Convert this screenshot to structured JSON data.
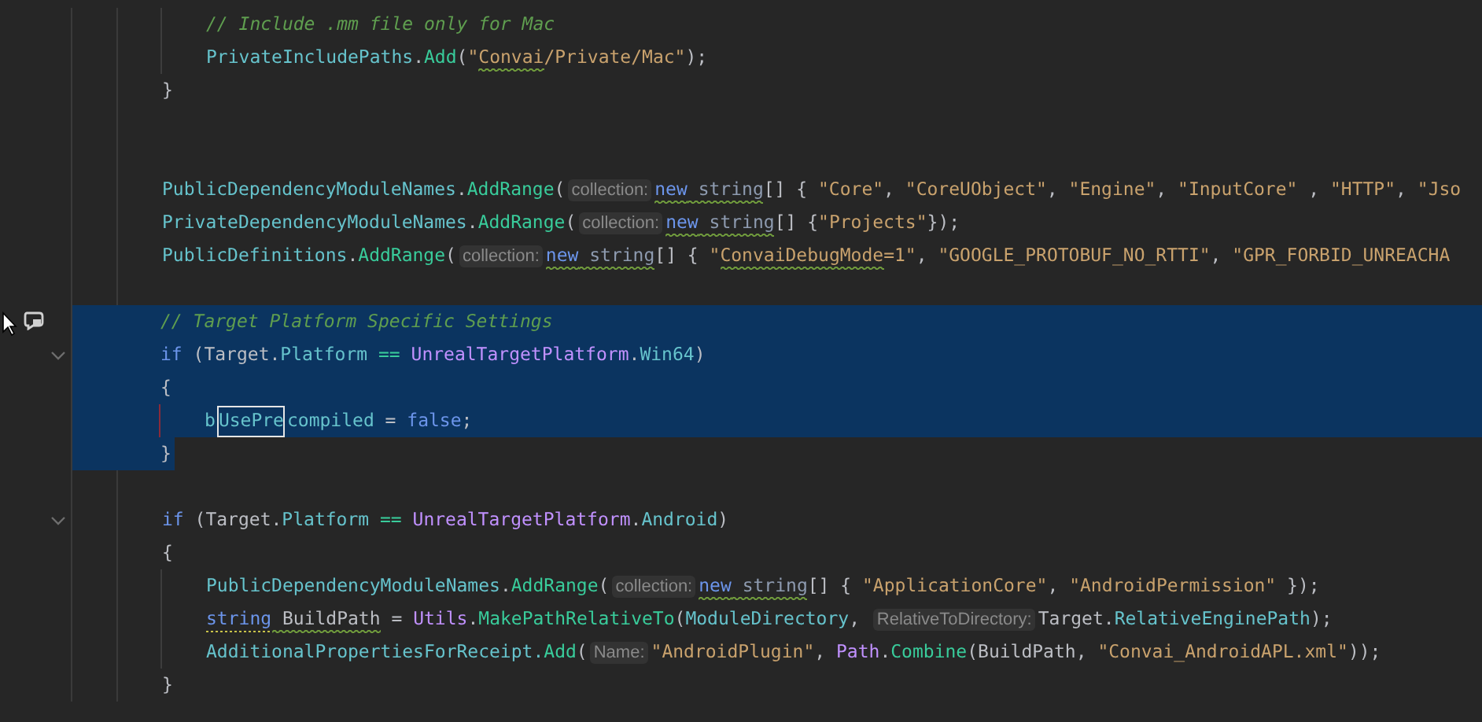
{
  "editor": {
    "lines": [
      {
        "selected": false,
        "indented": true,
        "tokens": [
          {
            "kind": "comment",
            "text": "// Include .mm file only for Mac"
          }
        ]
      },
      {
        "selected": false,
        "indented": true,
        "tokens": [
          {
            "kind": "field",
            "text": "PrivateIncludePaths"
          },
          {
            "kind": "plain",
            "text": "."
          },
          {
            "kind": "method",
            "text": "Add"
          },
          {
            "kind": "plain",
            "text": "("
          },
          {
            "kind": "string",
            "text": "\""
          },
          {
            "kind": "string",
            "text": "Convai",
            "squiggle": true
          },
          {
            "kind": "string",
            "text": "/Private/Mac\""
          },
          {
            "kind": "plain",
            "text": ");"
          }
        ]
      },
      {
        "selected": false,
        "tokens": [
          {
            "kind": "plain",
            "text": "}"
          }
        ]
      },
      {
        "selected": false
      },
      {
        "selected": false
      },
      {
        "selected": false,
        "tokens": [
          {
            "kind": "field",
            "text": "PublicDependencyModuleNames"
          },
          {
            "kind": "plain",
            "text": "."
          },
          {
            "kind": "method",
            "text": "AddRange"
          },
          {
            "kind": "plain",
            "text": "("
          },
          {
            "kind": "hint",
            "text": "collection:"
          },
          {
            "kind": "keyword",
            "text": "new",
            "squiggle": true
          },
          {
            "kind": "type",
            "text": " string",
            "squiggle": true
          },
          {
            "kind": "plain",
            "text": "[] { "
          },
          {
            "kind": "string",
            "text": "\"Core\""
          },
          {
            "kind": "plain",
            "text": ", "
          },
          {
            "kind": "string",
            "text": "\"CoreUObject\""
          },
          {
            "kind": "plain",
            "text": ", "
          },
          {
            "kind": "string",
            "text": "\"Engine\""
          },
          {
            "kind": "plain",
            "text": ", "
          },
          {
            "kind": "string",
            "text": "\"InputCore\""
          },
          {
            "kind": "plain",
            "text": " , "
          },
          {
            "kind": "string",
            "text": "\"HTTP\""
          },
          {
            "kind": "plain",
            "text": ", "
          },
          {
            "kind": "string",
            "text": "\"Jso"
          }
        ]
      },
      {
        "selected": false,
        "tokens": [
          {
            "kind": "field",
            "text": "PrivateDependencyModuleNames"
          },
          {
            "kind": "plain",
            "text": "."
          },
          {
            "kind": "method",
            "text": "AddRange"
          },
          {
            "kind": "plain",
            "text": "("
          },
          {
            "kind": "hint",
            "text": "collection:"
          },
          {
            "kind": "keyword",
            "text": "new",
            "squiggle": true
          },
          {
            "kind": "type",
            "text": " string",
            "squiggle": true
          },
          {
            "kind": "plain",
            "text": "[] {"
          },
          {
            "kind": "string",
            "text": "\"Projects\""
          },
          {
            "kind": "plain",
            "text": "});"
          }
        ]
      },
      {
        "selected": false,
        "tokens": [
          {
            "kind": "field",
            "text": "PublicDefinitions"
          },
          {
            "kind": "plain",
            "text": "."
          },
          {
            "kind": "method",
            "text": "AddRange"
          },
          {
            "kind": "plain",
            "text": "("
          },
          {
            "kind": "hint",
            "text": "collection:"
          },
          {
            "kind": "keyword",
            "text": "new",
            "squiggle": true
          },
          {
            "kind": "type",
            "text": " string",
            "squiggle": true
          },
          {
            "kind": "plain",
            "text": "[] { "
          },
          {
            "kind": "string",
            "text": "\""
          },
          {
            "kind": "string",
            "text": "ConvaiDebugMode",
            "squiggle": true
          },
          {
            "kind": "string",
            "text": "=1\""
          },
          {
            "kind": "plain",
            "text": ", "
          },
          {
            "kind": "string",
            "text": "\"GOOGLE_PROTOBUF_NO_RTTI\""
          },
          {
            "kind": "plain",
            "text": ", "
          },
          {
            "kind": "string",
            "text": "\"GPR_FORBID_UNREACHA"
          }
        ]
      },
      {
        "selected": false
      },
      {
        "selected": true,
        "hovered": true,
        "tokens": [
          {
            "kind": "comment",
            "text": "// Target Platform Specific Settings"
          }
        ]
      },
      {
        "selected": true,
        "fold": true,
        "tokens": [
          {
            "kind": "keyword",
            "text": "if"
          },
          {
            "kind": "plain",
            "text": " (Target."
          },
          {
            "kind": "field",
            "text": "Platform"
          },
          {
            "kind": "method",
            "text": " == "
          },
          {
            "kind": "class",
            "text": "UnrealTargetPlatform"
          },
          {
            "kind": "plain",
            "text": "."
          },
          {
            "kind": "field",
            "text": "Win64"
          },
          {
            "kind": "plain",
            "text": ")"
          }
        ]
      },
      {
        "selected": true,
        "tokens": [
          {
            "kind": "plain",
            "text": "{"
          }
        ]
      },
      {
        "selected": true,
        "indented": true,
        "changed": true,
        "tokens": [
          {
            "kind": "field",
            "text": "b"
          },
          {
            "kind": "field",
            "text": "UsePre",
            "boxed": true
          },
          {
            "kind": "field",
            "text": "compiled"
          },
          {
            "kind": "plain",
            "text": " = "
          },
          {
            "kind": "keyword",
            "text": "false"
          },
          {
            "kind": "plain",
            "text": ";"
          }
        ]
      },
      {
        "selected": true,
        "selection_end": true,
        "tokens": [
          {
            "kind": "plain",
            "text": "}"
          }
        ]
      },
      {
        "selected": false
      },
      {
        "selected": false,
        "fold": true,
        "tokens": [
          {
            "kind": "keyword",
            "text": "if"
          },
          {
            "kind": "plain",
            "text": " (Target."
          },
          {
            "kind": "field",
            "text": "Platform"
          },
          {
            "kind": "method",
            "text": " == "
          },
          {
            "kind": "class",
            "text": "UnrealTargetPlatform"
          },
          {
            "kind": "plain",
            "text": "."
          },
          {
            "kind": "field",
            "text": "Android"
          },
          {
            "kind": "plain",
            "text": ")"
          }
        ]
      },
      {
        "selected": false,
        "tokens": [
          {
            "kind": "plain",
            "text": "{"
          }
        ]
      },
      {
        "selected": false,
        "indented": true,
        "tokens": [
          {
            "kind": "field",
            "text": "PublicDependencyModuleNames"
          },
          {
            "kind": "plain",
            "text": "."
          },
          {
            "kind": "method",
            "text": "AddRange"
          },
          {
            "kind": "plain",
            "text": "("
          },
          {
            "kind": "hint",
            "text": "collection:"
          },
          {
            "kind": "keyword",
            "text": "new",
            "squiggle": true
          },
          {
            "kind": "type",
            "text": " string",
            "squiggle": true
          },
          {
            "kind": "plain",
            "text": "[] { "
          },
          {
            "kind": "string",
            "text": "\"ApplicationCore\""
          },
          {
            "kind": "plain",
            "text": ", "
          },
          {
            "kind": "string",
            "text": "\"AndroidPermission\""
          },
          {
            "kind": "plain",
            "text": " });"
          }
        ]
      },
      {
        "selected": false,
        "indented": true,
        "tokens": [
          {
            "kind": "keyword",
            "text": "string",
            "dotted": true
          },
          {
            "kind": "plain",
            "text": " BuildPath",
            "squiggle": true
          },
          {
            "kind": "plain",
            "text": " = "
          },
          {
            "kind": "class",
            "text": "Utils"
          },
          {
            "kind": "plain",
            "text": "."
          },
          {
            "kind": "method",
            "text": "MakePathRelativeTo"
          },
          {
            "kind": "plain",
            "text": "("
          },
          {
            "kind": "field",
            "text": "ModuleDirectory"
          },
          {
            "kind": "plain",
            "text": ", "
          },
          {
            "kind": "hint",
            "text": "RelativeToDirectory:"
          },
          {
            "kind": "plain",
            "text": "Target."
          },
          {
            "kind": "field",
            "text": "RelativeEnginePath"
          },
          {
            "kind": "plain",
            "text": ");"
          }
        ]
      },
      {
        "selected": false,
        "indented": true,
        "tokens": [
          {
            "kind": "field",
            "text": "AdditionalPropertiesForReceipt."
          },
          {
            "kind": "method",
            "text": "Add"
          },
          {
            "kind": "plain",
            "text": "("
          },
          {
            "kind": "hint",
            "text": "Name:"
          },
          {
            "kind": "string",
            "text": "\"AndroidPlugin\""
          },
          {
            "kind": "plain",
            "text": ", "
          },
          {
            "kind": "class",
            "text": "Path"
          },
          {
            "kind": "plain",
            "text": "."
          },
          {
            "kind": "method",
            "text": "Combine"
          },
          {
            "kind": "plain",
            "text": "(BuildPath, "
          },
          {
            "kind": "string",
            "text": "\"Convai_AndroidAPL.xml\""
          },
          {
            "kind": "plain",
            "text": "));"
          }
        ]
      },
      {
        "selected": false,
        "tokens": [
          {
            "kind": "plain",
            "text": "}"
          }
        ]
      }
    ]
  }
}
